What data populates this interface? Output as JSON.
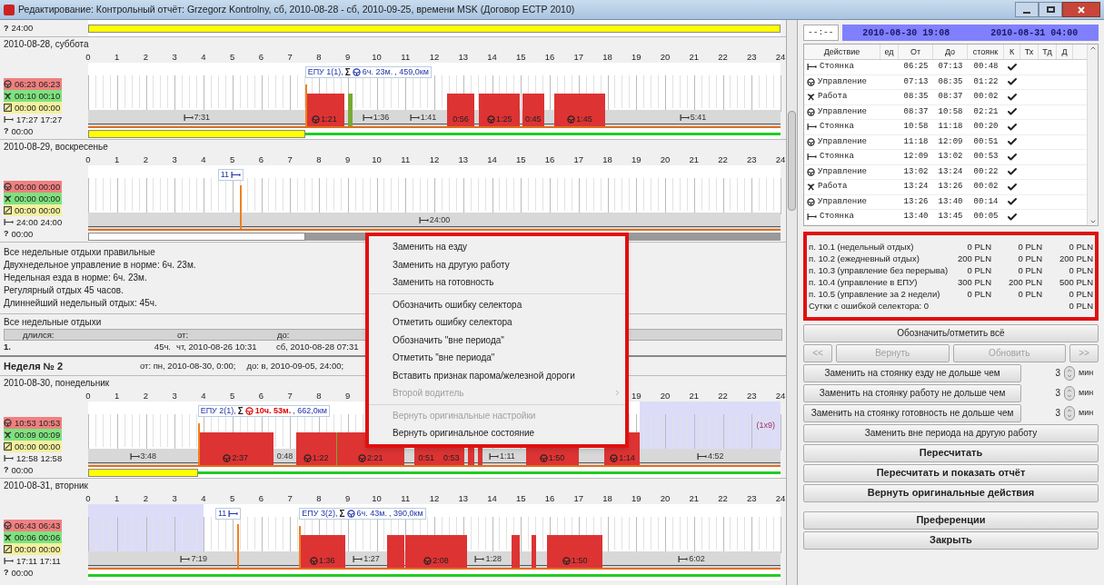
{
  "window": {
    "title": "Редактирование: Контрольный отчёт: Grzegorz Kontrolny, сб, 2010-08-28 - сб, 2010-09-25, времени MSK (Договор ЕСТР 2010)"
  },
  "top_fragment": {
    "symbol": "?",
    "value": "24:00",
    "bottom": [
      {
        "kind": "unknown"
      }
    ]
  },
  "week1_days": [
    {
      "date": "2010-08-28, суббота",
      "hours": [
        "0",
        "1",
        "2",
        "3",
        "4",
        "5",
        "6",
        "7",
        "8",
        "9",
        "10",
        "11",
        "12",
        "13",
        "14",
        "15",
        "16",
        "17",
        "18",
        "19",
        "20",
        "21",
        "22",
        "23",
        "24"
      ],
      "stats": [
        {
          "kind": "drive",
          "value": "06:23 06:23"
        },
        {
          "kind": "work",
          "value": "00:10 00:10"
        },
        {
          "kind": "avail",
          "value": "00:00 00:00"
        },
        {
          "kind": "rest",
          "value": "17:27 17:27"
        },
        {
          "kind": "unknown",
          "symbol": "?",
          "value": "00:00"
        }
      ],
      "annotation": {
        "prefix": "ЕПУ 1(1),",
        "sigma": "Σ",
        "duration": "6ч. 23м.",
        "suffix": ", 459,0км",
        "over_limit": false
      },
      "segments": [
        {
          "kind": "rest",
          "label": "7:31"
        },
        {
          "kind": "drive",
          "label": "1:21"
        },
        {
          "kind": "work"
        },
        {
          "kind": "rest",
          "label": "1:36"
        },
        {
          "kind": "rest",
          "label": "1:41"
        },
        {
          "kind": "drive",
          "label": "0:56"
        },
        {
          "kind": "drive",
          "label": "1:25"
        },
        {
          "kind": "drive",
          "label": "0:45"
        },
        {
          "kind": "drive",
          "label": "1:45"
        },
        {
          "kind": "rest",
          "label": "5:41"
        }
      ],
      "bottom": [
        {
          "kind": "unknown"
        },
        {
          "kind": "known"
        }
      ]
    },
    {
      "date": "2010-08-29, воскресенье",
      "hours": [
        "0",
        "1",
        "2",
        "3",
        "4",
        "5",
        "6",
        "7",
        "8",
        "9",
        "10",
        "11",
        "12",
        "13",
        "14",
        "15",
        "16",
        "17",
        "18",
        "19",
        "20",
        "21",
        "22",
        "23",
        "24"
      ],
      "stats": [
        {
          "kind": "drive",
          "value": "00:00 00:00"
        },
        {
          "kind": "work",
          "value": "00:00 00:00"
        },
        {
          "kind": "avail",
          "value": "00:00 00:00"
        },
        {
          "kind": "rest",
          "value": "24:00 24:00"
        },
        {
          "kind": "unknown",
          "symbol": "?",
          "value": "00:00"
        }
      ],
      "markers": [
        {
          "text": "11"
        }
      ],
      "segments": [
        {
          "kind": "rest",
          "label": "24:00"
        }
      ],
      "bottom": [
        {
          "kind": "none"
        },
        {
          "kind": "future"
        }
      ]
    }
  ],
  "summary_lines": [
    "Все недельные отдыхи правильные",
    "Двухнедельное управление в норме: 6ч. 23м.",
    "Недельная езда в норме: 6ч. 23м.",
    "Регулярный отдых 45 часов.",
    "Длиннейший недельный отдых: 45ч."
  ],
  "weekly_rests": {
    "title": "Все недельные отдыхи",
    "columns": [
      "длился:",
      "от:",
      "до:"
    ],
    "rows": [
      {
        "index": "1.",
        "duration": "45ч.",
        "from": "чт, 2010-08-26 10:31",
        "to": "сб, 2010-08-28 07:31"
      }
    ]
  },
  "week2": {
    "title": "Неделя № 2",
    "from": "от: пн, 2010-08-30, 0:00;",
    "to": "до: в, 2010-09-05, 24:00;"
  },
  "week2_days": [
    {
      "date": "2010-08-30, понедельник",
      "hours": [
        "0",
        "1",
        "2",
        "3",
        "4",
        "5",
        "6",
        "7",
        "8",
        "9",
        "19",
        "20",
        "21",
        "22",
        "23",
        "24"
      ],
      "stats": [
        {
          "kind": "drive",
          "value": "10:53 10:53"
        },
        {
          "kind": "work",
          "value": "00:09 00:09"
        },
        {
          "kind": "avail",
          "value": "00:00 00:00"
        },
        {
          "kind": "rest",
          "value": "12:58 12:58"
        },
        {
          "kind": "unknown",
          "symbol": "?",
          "value": "00:00"
        }
      ],
      "night": true,
      "annotation": {
        "prefix": "ЕПУ 2(1),",
        "sigma": "Σ",
        "duration": "10ч. 53м.",
        "suffix": ", 662,0км",
        "over_limit": true
      },
      "note": "(1х9)",
      "segments": [
        {
          "kind": "rest",
          "label": "3:48"
        },
        {
          "kind": "drive",
          "label": "2:37"
        },
        {
          "kind": "rest",
          "label": "0:48"
        },
        {
          "kind": "drive",
          "label": "1:22"
        },
        {
          "kind": "work"
        },
        {
          "kind": "drive",
          "label": "2:21"
        },
        {
          "kind": "drive",
          "label": "0:51"
        },
        {
          "kind": "drive",
          "label": "0:53"
        },
        {
          "kind": "drive"
        },
        {
          "kind": "drive"
        },
        {
          "kind": "rest",
          "label": "1:11"
        },
        {
          "kind": "drive",
          "label": "1:50"
        },
        {
          "kind": "drive",
          "label": "1:14"
        },
        {
          "kind": "rest",
          "label": "4:52"
        }
      ],
      "bottom": [
        {
          "kind": "unknown"
        },
        {
          "kind": "known"
        }
      ]
    },
    {
      "date": "2010-08-31, вторник",
      "hours": [
        "0",
        "1",
        "2",
        "3",
        "4",
        "5",
        "6",
        "7",
        "8",
        "9",
        "10",
        "11",
        "12",
        "13",
        "14",
        "15",
        "16",
        "17",
        "18",
        "19",
        "20",
        "21",
        "22",
        "23",
        "24"
      ],
      "stats": [
        {
          "kind": "drive",
          "value": "06:43 06:43"
        },
        {
          "kind": "work",
          "value": "00:06 00:06"
        },
        {
          "kind": "avail",
          "value": "00:00 00:00"
        },
        {
          "kind": "rest",
          "value": "17:11 17:11"
        },
        {
          "kind": "unknown",
          "symbol": "?",
          "value": "00:00"
        }
      ],
      "night": true,
      "annotation": {
        "prefix": "ЕПУ 3(2),",
        "sigma": "Σ",
        "duration": "6ч. 43м.",
        "suffix": ", 390,0км",
        "over_limit": false
      },
      "markers": [
        {
          "text": "11"
        }
      ],
      "segments": [
        {
          "kind": "rest",
          "label": "7:19"
        },
        {
          "kind": "drive",
          "label": "1:36"
        },
        {
          "kind": "rest",
          "label": "1:27"
        },
        {
          "kind": "drive"
        },
        {
          "kind": "drive",
          "label": "2:08"
        },
        {
          "kind": "rest",
          "label": "1:28"
        },
        {
          "kind": "drive"
        },
        {
          "kind": "drive"
        },
        {
          "kind": "drive",
          "label": "1:50"
        },
        {
          "kind": "rest",
          "label": "6:02"
        }
      ],
      "bottom": [
        {
          "kind": "known"
        }
      ]
    }
  ],
  "context_menu": {
    "groups": [
      [
        {
          "label": "Заменить на езду",
          "disabled": false
        },
        {
          "label": "Заменить на другую работу",
          "disabled": false
        },
        {
          "label": "Заменить на готовность",
          "disabled": false
        }
      ],
      [
        {
          "label": "Обозначить ошибку селектора",
          "disabled": false
        },
        {
          "label": "Отметить ошибку селектора",
          "disabled": false
        },
        {
          "label": "Обозначить \"вне периода\"",
          "disabled": false
        },
        {
          "label": "Отметить \"вне периода\"",
          "disabled": false
        },
        {
          "label": "Вставить признак парома/железной дороги",
          "disabled": false
        },
        {
          "label": "Второй водитель",
          "disabled": true,
          "submenu": true
        }
      ],
      [
        {
          "label": "Вернуть оригинальные настройки",
          "disabled": true
        },
        {
          "label": "Вернуть оригинальное состояние",
          "disabled": false
        }
      ]
    ]
  },
  "range": {
    "time": "--:--",
    "from": "2010-08-30 19:08",
    "to": "2010-08-31 04:00"
  },
  "actions_table": {
    "columns": [
      "Действие",
      "ед",
      "От",
      "До",
      "стоянк",
      "К",
      "Тх",
      "Тд",
      "Д"
    ],
    "rows": [
      {
        "kind": "rest",
        "action": "Стоянка",
        "from": "06:25",
        "to": "07:13",
        "duration": "00:48",
        "checked": true
      },
      {
        "kind": "drive",
        "action": "Управление",
        "from": "07:13",
        "to": "08:35",
        "duration": "01:22",
        "checked": true
      },
      {
        "kind": "work",
        "action": "Работа",
        "from": "08:35",
        "to": "08:37",
        "duration": "00:02",
        "checked": true
      },
      {
        "kind": "drive",
        "action": "Управление",
        "from": "08:37",
        "to": "10:58",
        "duration": "02:21",
        "checked": true
      },
      {
        "kind": "rest",
        "action": "Стоянка",
        "from": "10:58",
        "to": "11:18",
        "duration": "00:20",
        "checked": true
      },
      {
        "kind": "drive",
        "action": "Управление",
        "from": "11:18",
        "to": "12:09",
        "duration": "00:51",
        "checked": true
      },
      {
        "kind": "rest",
        "action": "Стоянка",
        "from": "12:09",
        "to": "13:02",
        "duration": "00:53",
        "checked": true
      },
      {
        "kind": "drive",
        "action": "Управление",
        "from": "13:02",
        "to": "13:24",
        "duration": "00:22",
        "checked": true
      },
      {
        "kind": "work",
        "action": "Работа",
        "from": "13:24",
        "to": "13:26",
        "duration": "00:02",
        "checked": true
      },
      {
        "kind": "drive",
        "action": "Управление",
        "from": "13:26",
        "to": "13:40",
        "duration": "00:14",
        "checked": true
      },
      {
        "kind": "rest",
        "action": "Стоянка",
        "from": "13:40",
        "to": "13:45",
        "duration": "00:05",
        "checked": true
      }
    ]
  },
  "penalties": {
    "rows": [
      {
        "label": "п. 10.1 (недельный отдых)",
        "a": "0 PLN",
        "b": "0 PLN",
        "c": "0 PLN"
      },
      {
        "label": "п. 10.2 (ежедневный отдых)",
        "a": "200 PLN",
        "b": "0 PLN",
        "c": "200 PLN"
      },
      {
        "label": "п. 10.3 (управление без перерыва)",
        "a": "0 PLN",
        "b": "0 PLN",
        "c": "0 PLN"
      },
      {
        "label": "п. 10.4 (управление в ЕПУ)",
        "a": "300 PLN",
        "b": "200 PLN",
        "c": "500 PLN"
      },
      {
        "label": "п. 10.5 (управление за 2 недели)",
        "a": "0 PLN",
        "b": "0 PLN",
        "c": "0 PLN"
      }
    ],
    "selector_errors": {
      "label": "Сутки с ошибкой селектора: 0",
      "total": "0 PLN"
    }
  },
  "mark_all_button": "Обозначить/отметить всё",
  "nav": [
    {
      "label": "<<",
      "disabled": true
    },
    {
      "label": "Вернуть",
      "disabled": true
    },
    {
      "label": "Обновить",
      "disabled": true
    },
    {
      "label": ">>",
      "disabled": true
    }
  ],
  "replace_rows": [
    {
      "label": "Заменить на стоянку езду не дольше чем",
      "value": "3",
      "unit": "мин"
    },
    {
      "label": "Заменить на стоянку работу не дольше чем",
      "value": "3",
      "unit": "мин"
    },
    {
      "label": "Заменить на стоянку готовность не дольше чем",
      "value": "3",
      "unit": "мин"
    }
  ],
  "buttons": [
    {
      "label": "Заменить вне периода на другую работу",
      "bold": false
    },
    {
      "label": "Пересчитать",
      "bold": true
    },
    {
      "label": "Пересчитать и показать отчёт",
      "bold": true
    },
    {
      "label": "Вернуть оригинальные действия",
      "bold": true
    }
  ],
  "bottom_buttons": [
    {
      "label": "Преференции",
      "bold": true
    },
    {
      "label": "Закрыть",
      "bold": true
    }
  ]
}
